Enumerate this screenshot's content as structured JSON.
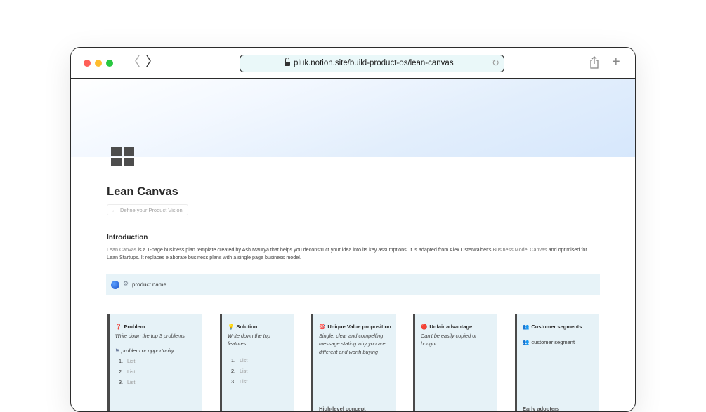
{
  "browser": {
    "url": "pluk.notion.site/build-product-os/lean-canvas",
    "back_glyph": "〈",
    "forward_glyph": "〉",
    "new_tab_glyph": "+",
    "reload_glyph": "↻"
  },
  "page": {
    "title": "Lean Canvas",
    "backlink": {
      "arrow": "←",
      "label": "Define your Product Vision"
    },
    "icon": "dashboard-grid-icon"
  },
  "intro": {
    "heading": "Introduction",
    "link1": "Lean Canvas",
    "text1": " is a 1-page business plan template created by Ash Maurya that helps you deconstruct your idea into its key assumptions. It is adapted from Alex Osterwalder's ",
    "link2": "Business Model Canvas",
    "text2": " and optimised for Lean Startups. It replaces elaborate business plans with a single page business model."
  },
  "callout": {
    "icon": "globe-icon",
    "prop_icon": "⚙",
    "text": "product name"
  },
  "cards": [
    {
      "icon": "❓",
      "title": "Problem",
      "subtitle": "Write down the top 3 problems",
      "tag_icon": "⚑",
      "tag": "problem or opportunity",
      "list": [
        {
          "n": "1.",
          "t": "List"
        },
        {
          "n": "2.",
          "t": "List"
        },
        {
          "n": "3.",
          "t": "List"
        }
      ]
    },
    {
      "icon": "💡",
      "title": "Solution",
      "subtitle": "Write down the top features",
      "list": [
        {
          "n": "1.",
          "t": "List"
        },
        {
          "n": "2.",
          "t": "List"
        },
        {
          "n": "3.",
          "t": "List"
        }
      ]
    },
    {
      "icon": "🎯",
      "title": "Unique Value proposition",
      "subtitle": "Single, clear and compelling message stating why you are different and worth buying",
      "peek": "High-level concept"
    },
    {
      "icon": "🔴",
      "title": "Unfair advantage",
      "subtitle": "Can't be easily copied or bought"
    },
    {
      "icon": "👥",
      "title": "Customer segments",
      "tag_icon": "👥",
      "tag": "customer segment",
      "peek": "Early adopters"
    }
  ],
  "colors": {
    "callout_bg": "#e7f3f8",
    "card_bg": "#e6f2f7",
    "url_bg": "#eaf8f9"
  }
}
